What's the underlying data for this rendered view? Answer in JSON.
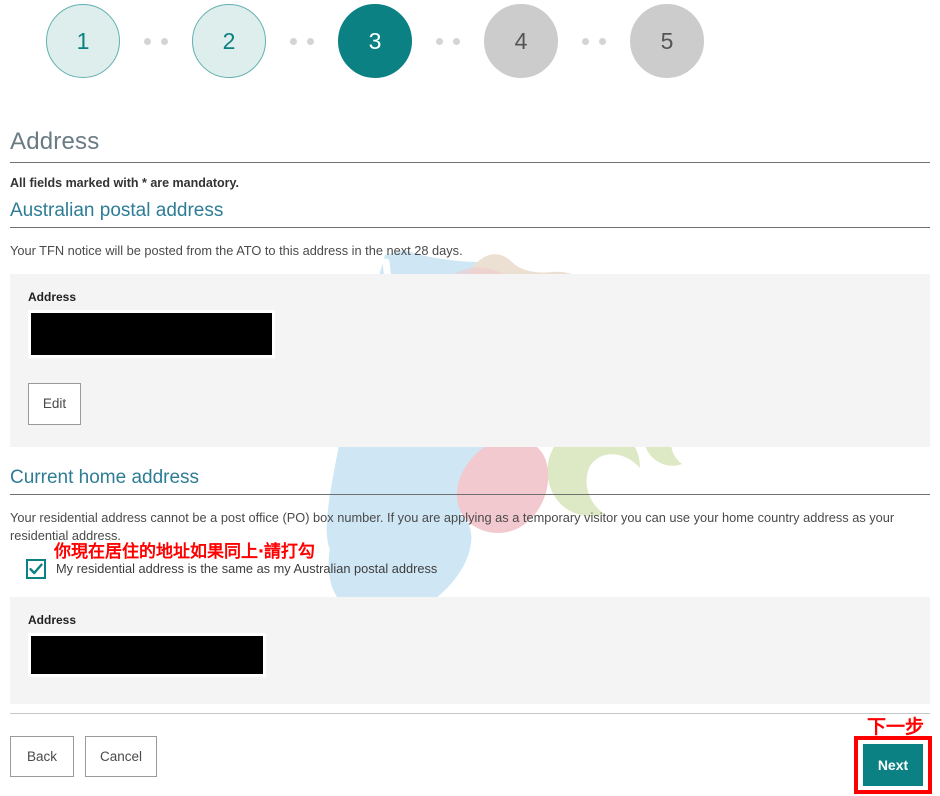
{
  "stepper": {
    "steps": [
      {
        "label": "1",
        "state": "done"
      },
      {
        "label": "2",
        "state": "done"
      },
      {
        "label": "3",
        "state": "active"
      },
      {
        "label": "4",
        "state": "todo"
      },
      {
        "label": "5",
        "state": "todo"
      }
    ]
  },
  "page": {
    "title": "Address",
    "mandatory_note": "All fields marked with * are mandatory."
  },
  "postal_section": {
    "heading": "Australian postal address",
    "help_text": "Your TFN notice will be posted from the ATO to this address in the next 28 days.",
    "field_label": "Address",
    "field_value": "",
    "edit_label": "Edit"
  },
  "home_section": {
    "heading": "Current home address",
    "help_text": "Your residential address cannot be a post office (PO) box number. If you are applying as a temporary visitor you can use your home country address as your residential address.",
    "checkbox": {
      "label": "My residential address is the same as my Australian postal address",
      "checked": true,
      "annotation": "你現在居住的地址如果同上‧請打勾"
    },
    "field_label": "Address",
    "field_value": ""
  },
  "footer": {
    "back_label": "Back",
    "cancel_label": "Cancel",
    "next_label": "Next",
    "next_annotation": "下一步"
  },
  "colors": {
    "teal": "#0b8184",
    "step_done_fill": "#ddeeed",
    "step_todo_fill": "#cccccc",
    "section_heading": "#2e7d96",
    "page_title": "#6a7b84",
    "panel_bg": "#f4f4f4",
    "annotation_red": "#ff0000",
    "redaction": "#000000"
  }
}
